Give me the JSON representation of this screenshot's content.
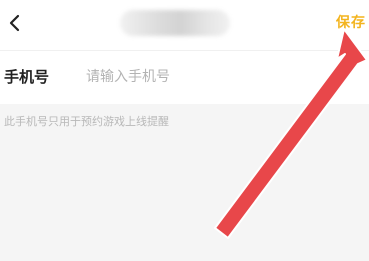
{
  "header": {
    "back_icon": "chevron-left-icon",
    "save_label": "保存",
    "save_color": "#f3b41f"
  },
  "form": {
    "phone_label": "手机号",
    "phone_value": "",
    "phone_placeholder": "请输入手机号"
  },
  "hint": "此手机号只用于预约游戏上线提醒",
  "annotation": {
    "arrow_color": "#e8474a"
  }
}
